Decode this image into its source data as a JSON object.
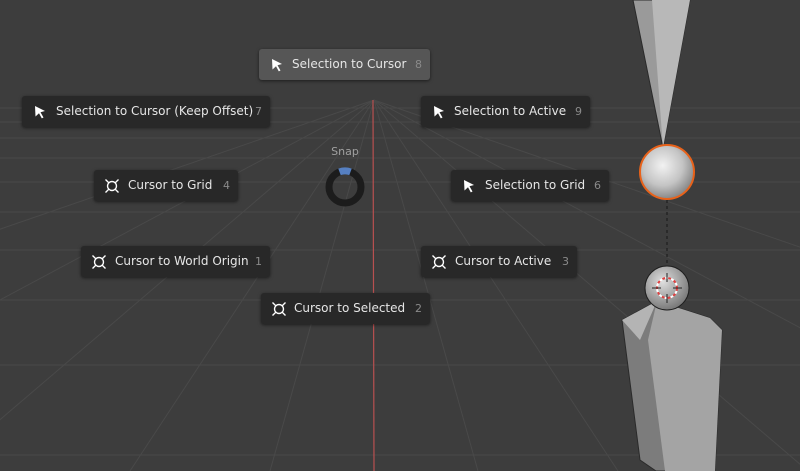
{
  "pie_menu": {
    "title": "Snap",
    "items": [
      {
        "label": "Selection to Cursor",
        "hotkey": "8",
        "icon": "cursor-arrow-icon",
        "active": true
      },
      {
        "label": "Selection to Cursor (Keep Offset)",
        "hotkey": "7",
        "icon": "cursor-arrow-icon"
      },
      {
        "label": "Selection to Active",
        "hotkey": "9",
        "icon": "cursor-arrow-icon"
      },
      {
        "label": "Cursor to Grid",
        "hotkey": "4",
        "icon": "3d-cursor-icon"
      },
      {
        "label": "Selection to Grid",
        "hotkey": "6",
        "icon": "cursor-arrow-icon"
      },
      {
        "label": "Cursor to World Origin",
        "hotkey": "1",
        "icon": "3d-cursor-icon"
      },
      {
        "label": "Cursor to Active",
        "hotkey": "3",
        "icon": "3d-cursor-icon"
      },
      {
        "label": "Cursor to Selected",
        "hotkey": "2",
        "icon": "3d-cursor-icon"
      }
    ]
  },
  "colors": {
    "background": "#3d3d3d",
    "menu_item": "#282828",
    "menu_item_active": "#565656",
    "axis_red": "#b85050",
    "selection_orange": "#e8621a",
    "pie_direction_blue": "#5680c2"
  }
}
